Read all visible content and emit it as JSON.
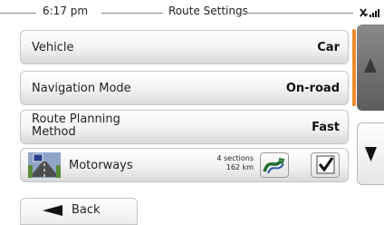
{
  "header": {
    "time": "6:17 pm",
    "title": "Route Settings"
  },
  "settings": [
    {
      "label": "Vehicle",
      "value": "Car"
    },
    {
      "label": "Navigation Mode",
      "value": "On-road"
    },
    {
      "label": "Route Planning Method",
      "label_line1": "Route Planning",
      "label_line2": "Method",
      "value": "Fast"
    }
  ],
  "motorways": {
    "label": "Motorways",
    "sections_line1": "4 sections",
    "sections_line2": "162 km",
    "checked": true,
    "icon": "motorway-icon"
  },
  "scroll": {
    "position_fraction": 0.5
  },
  "icons": {
    "scroll_up": "triangle-up-icon",
    "scroll_down": "triangle-down-icon",
    "route_detail": "route-curve-icon",
    "checkbox": "checkmark-icon",
    "back": "back-arrow-icon",
    "status": "signal-icon"
  },
  "back": {
    "label": "Back"
  },
  "colors": {
    "scroll_indicator": "#f08a2e",
    "up_button": "#6e6e6e"
  }
}
